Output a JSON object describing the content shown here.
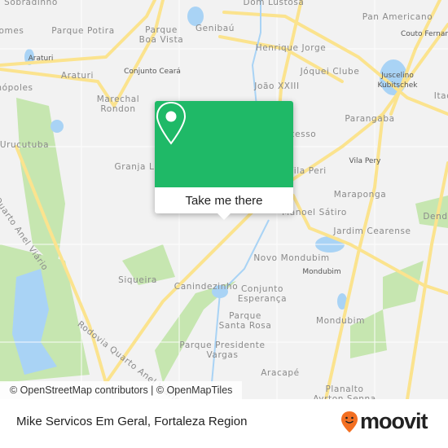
{
  "map": {
    "labels": [
      "Sobradinho",
      "Parque Potira",
      "Parque\nBoa Vista",
      "Genibaú",
      "Dom Lustosa",
      "Pan Americano",
      "Couto Fernandes",
      "Henrique Jorge",
      "Araturi",
      "Araturi",
      "Conjunto Ceará",
      "Jóquei Clube",
      "Juscelino\nKubitschek",
      "omes",
      "nópoles",
      "Marechal\nRondon",
      "João XXIII",
      "Itao",
      "Parangaba",
      "cesso",
      "Urucutuba",
      "Vila Pery",
      "Granja L",
      "Vila Peri",
      "Maraponga",
      "Manoel Sátiro",
      "Dende",
      "Jardim Cearense",
      "Novo Mondubim",
      "Mondubim",
      "Siqueira",
      "Canindezinho",
      "Conjunto\nEsperança",
      "Parque\nSanta Rosa",
      "Mondubim",
      "Parque Presidente\nVargas",
      "Aracapé",
      "Planalto\nAyrton Senna",
      "Quarto Anel Viário",
      "Rodovia Quarto Anel Viário"
    ],
    "attribution": "© OpenStreetMap contributors | © OpenMapTiles",
    "colors": {
      "road": "#fbe38e",
      "water": "#a9d3f5",
      "park": "#c6e6b0",
      "land": "#f2f2f2"
    }
  },
  "popup": {
    "icon": "map-pin-icon",
    "button_label": "Take me there",
    "color": "#1fb967"
  },
  "footer": {
    "title": "Mike Servicos Em Geral, Fortaleza Region",
    "logo_text": "moovit",
    "logo_color": "#f36f21"
  }
}
